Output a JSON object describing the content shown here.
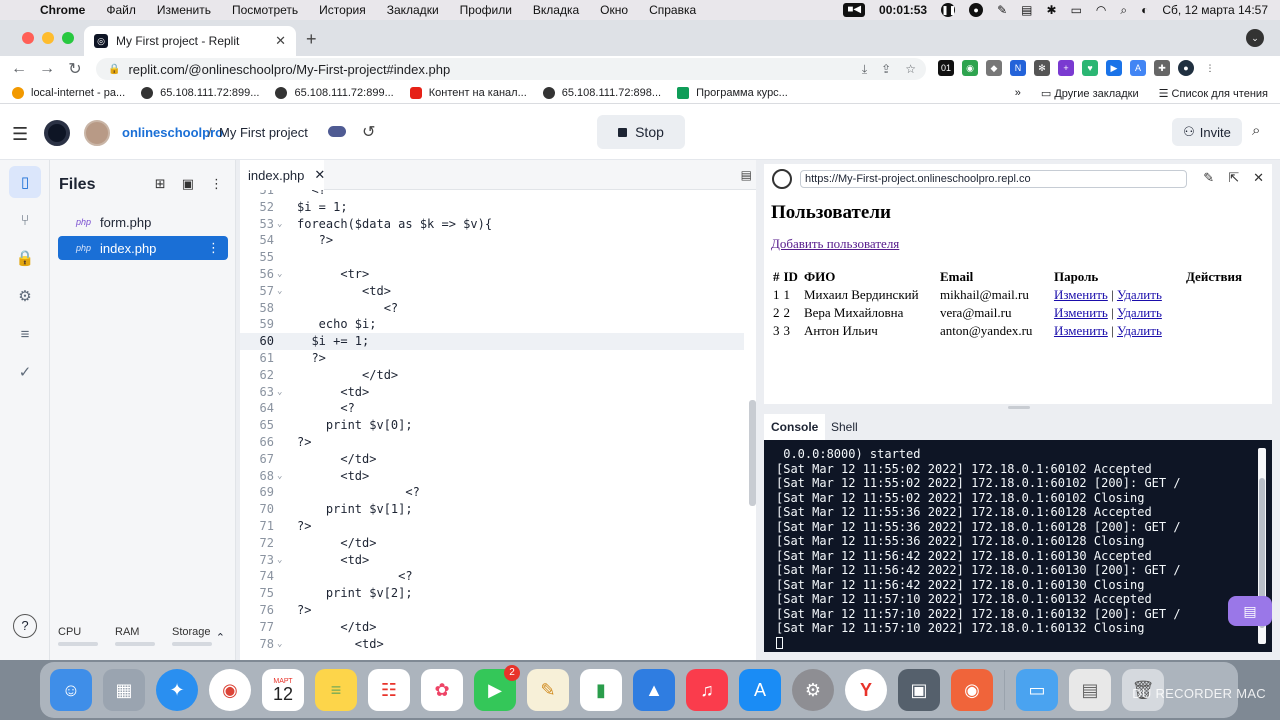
{
  "menubar": {
    "items": [
      "Chrome",
      "Файл",
      "Изменить",
      "Посмотреть",
      "История",
      "Закладки",
      "Профили",
      "Вкладка",
      "Окно",
      "Справка"
    ],
    "timer": "00:01:53",
    "date_time": "Сб, 12 марта  14:57"
  },
  "browser": {
    "tab_title": "My First project - Replit",
    "url": "replit.com/@onlineschoolpro/My-First-project#index.php",
    "bookmarks": [
      "local-internet - ра...",
      "65.108.111.72:899...",
      "65.108.111.72:899...",
      "Контент на канал...",
      "65.108.111.72:898...",
      "Программа курс..."
    ],
    "bookmarks_overflow": "»",
    "other_bookmarks": "Другие закладки",
    "reading_list": "Список для чтения"
  },
  "replit": {
    "username": "onlineschoolpro",
    "separator": "/",
    "project": "My First project",
    "stop_label": "Stop",
    "invite_label": "Invite",
    "files_title": "Files",
    "files": [
      {
        "icon": "php",
        "name": "form.php"
      },
      {
        "icon": "php",
        "name": "index.php"
      }
    ],
    "resources": [
      "CPU",
      "RAM",
      "Storage"
    ],
    "editor_tab": "index.php"
  },
  "code": {
    "active_line": 60,
    "lines": [
      {
        "n": "51",
        "fold": "",
        "indent": "",
        "text": "  <?"
      },
      {
        "n": "52",
        "fold": "",
        "indent": "",
        "text": "$i = 1;"
      },
      {
        "n": "53",
        "fold": "⌄",
        "indent": "",
        "text": "foreach($data as $k => $v){"
      },
      {
        "n": "54",
        "fold": "",
        "indent": "",
        "text": "   ?>"
      },
      {
        "n": "55",
        "fold": "",
        "indent": "",
        "text": ""
      },
      {
        "n": "56",
        "fold": "⌄",
        "indent": "",
        "text": "      <tr>"
      },
      {
        "n": "57",
        "fold": "⌄",
        "indent": "",
        "text": "         <td>"
      },
      {
        "n": "58",
        "fold": "",
        "indent": "",
        "text": "            <?"
      },
      {
        "n": "59",
        "fold": "",
        "indent": "",
        "text": "   echo $i;"
      },
      {
        "n": "60",
        "fold": "",
        "indent": "",
        "text": "  $i += 1;"
      },
      {
        "n": "61",
        "fold": "",
        "indent": "",
        "text": "  ?>"
      },
      {
        "n": "62",
        "fold": "",
        "indent": "",
        "text": "         </td>"
      },
      {
        "n": "63",
        "fold": "⌄",
        "indent": "",
        "text": "      <td>"
      },
      {
        "n": "64",
        "fold": "",
        "indent": "",
        "text": "      <?"
      },
      {
        "n": "65",
        "fold": "",
        "indent": "",
        "text": "    print $v[0];"
      },
      {
        "n": "66",
        "fold": "",
        "indent": "",
        "text": "?>"
      },
      {
        "n": "67",
        "fold": "",
        "indent": "",
        "text": "      </td>"
      },
      {
        "n": "68",
        "fold": "⌄",
        "indent": "",
        "text": "      <td>"
      },
      {
        "n": "69",
        "fold": "",
        "indent": "",
        "text": "               <?"
      },
      {
        "n": "70",
        "fold": "",
        "indent": "",
        "text": "    print $v[1];"
      },
      {
        "n": "71",
        "fold": "",
        "indent": "",
        "text": "?>"
      },
      {
        "n": "72",
        "fold": "",
        "indent": "",
        "text": "      </td>"
      },
      {
        "n": "73",
        "fold": "⌄",
        "indent": "",
        "text": "      <td>"
      },
      {
        "n": "74",
        "fold": "",
        "indent": "",
        "text": "              <?"
      },
      {
        "n": "75",
        "fold": "",
        "indent": "",
        "text": "    print $v[2];"
      },
      {
        "n": "76",
        "fold": "",
        "indent": "",
        "text": "?>"
      },
      {
        "n": "77",
        "fold": "",
        "indent": "",
        "text": "      </td>"
      },
      {
        "n": "78",
        "fold": "⌄",
        "indent": "",
        "text": "        <td>"
      }
    ]
  },
  "webview": {
    "url": "https://My-First-project.onlineschoolpro.repl.co",
    "heading": "Пользователи",
    "add_link": "Добавить пользователя",
    "columns": [
      "#",
      "ID",
      "ФИО",
      "Email",
      "Пароль",
      "Действия"
    ],
    "rows": [
      {
        "num": "1",
        "id": "1",
        "name": "Михаил Вердинский",
        "email": "mikhail@mail.ru"
      },
      {
        "num": "2",
        "id": "2",
        "name": "Вера Михайловна",
        "email": "vera@mail.ru"
      },
      {
        "num": "3",
        "id": "3",
        "name": "Антон Ильич",
        "email": "anton@yandex.ru"
      }
    ],
    "edit_label": "Изменить",
    "sep": "|",
    "delete_label": "Удалить"
  },
  "console": {
    "tabs": [
      "Console",
      "Shell"
    ],
    "lines": [
      " 0.0.0:8000) started",
      "[Sat Mar 12 11:55:02 2022] 172.18.0.1:60102 Accepted",
      "[Sat Mar 12 11:55:02 2022] 172.18.0.1:60102 [200]: GET /",
      "[Sat Mar 12 11:55:02 2022] 172.18.0.1:60102 Closing",
      "[Sat Mar 12 11:55:36 2022] 172.18.0.1:60128 Accepted",
      "[Sat Mar 12 11:55:36 2022] 172.18.0.1:60128 [200]: GET /",
      "[Sat Mar 12 11:55:36 2022] 172.18.0.1:60128 Closing",
      "[Sat Mar 12 11:56:42 2022] 172.18.0.1:60130 Accepted",
      "[Sat Mar 12 11:56:42 2022] 172.18.0.1:60130 [200]: GET /",
      "[Sat Mar 12 11:56:42 2022] 172.18.0.1:60130 Closing",
      "[Sat Mar 12 11:57:10 2022] 172.18.0.1:60132 Accepted",
      "[Sat Mar 12 11:57:10 2022] 172.18.0.1:60132 [200]: GET /",
      "[Sat Mar 12 11:57:10 2022] 172.18.0.1:60132 Closing"
    ]
  },
  "dock": {
    "calendar_month": "МАРТ",
    "calendar_day": "12",
    "facetime_badge": "2",
    "watermark": "DU RECORDER MAC"
  },
  "colors": {
    "accent": "#1a6fd6",
    "console_bg": "#0e1525",
    "chat_button": "#9a77e8"
  }
}
